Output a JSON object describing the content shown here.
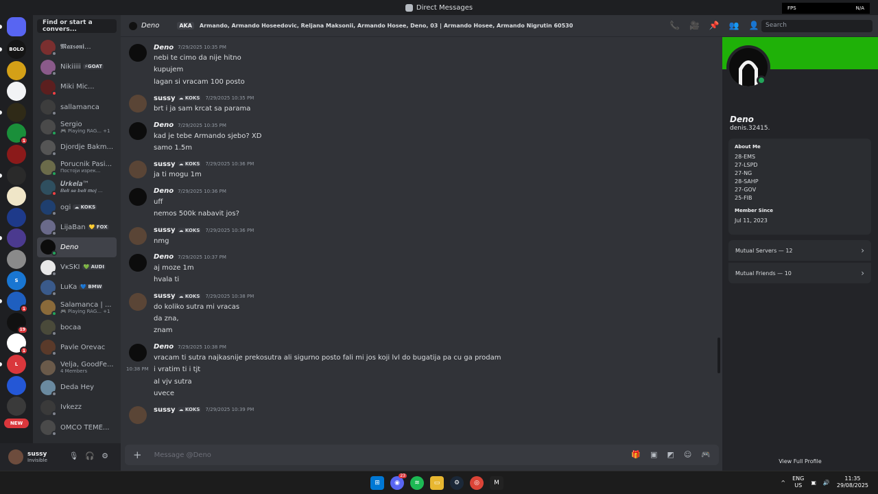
{
  "titlebar": {
    "title": "Direct Messages",
    "fps_label": "FPS",
    "fps_value": "N/A"
  },
  "servers": [
    {
      "label": "",
      "bg": "#5865f2",
      "dm": true
    },
    {
      "label": "BOLO",
      "bg": "#151515"
    },
    {
      "label": "",
      "bg": "#d4a017"
    },
    {
      "label": "",
      "bg": "#f2f3f5"
    },
    {
      "label": "",
      "bg": "#2f2a17"
    },
    {
      "label": "",
      "bg": "#1a8f3a",
      "badge": "1"
    },
    {
      "label": "",
      "bg": "#8b1a1a"
    },
    {
      "label": "",
      "bg": "#2a2a2a"
    },
    {
      "label": "",
      "bg": "#f0e6c8"
    },
    {
      "label": "",
      "bg": "#1e3a8a"
    },
    {
      "label": "",
      "bg": "#4b3a8f"
    },
    {
      "label": "",
      "bg": "#8a8a8a"
    },
    {
      "label": "S",
      "bg": "#1976d2"
    },
    {
      "label": "",
      "bg": "#1f5fbf",
      "badge": "1"
    },
    {
      "label": "",
      "bg": "#111111",
      "badge": "19"
    },
    {
      "label": "",
      "bg": "#ffffff",
      "badge": "1"
    },
    {
      "label": "L",
      "bg": "#da373c"
    },
    {
      "label": "",
      "bg": "#2457d6"
    },
    {
      "label": "",
      "bg": "#3a3a3a"
    }
  ],
  "new_label": "NEW",
  "dm_search": "Find or start a convers...",
  "dms": [
    {
      "name": "𝕸𝖆𝖝𝖘𝖔𝖓𝖎...",
      "sub": "",
      "tag": "",
      "av": "#7a2f2f",
      "status": "#80848e"
    },
    {
      "name": "Nikiiiii",
      "sub": "",
      "tag": "⚡GOAT",
      "av": "#8a5a8a",
      "status": "#80848e"
    },
    {
      "name": "Miki Mic...",
      "sub": "",
      "tag": "",
      "av": "#5c1f1f",
      "status": "#f23f43"
    },
    {
      "name": "sallamanca",
      "sub": "",
      "tag": "",
      "av": "#3d3d3d",
      "status": "#80848e"
    },
    {
      "name": "Sergio",
      "sub": "🎮 Playing RAG... +1",
      "tag": "",
      "av": "#4a4a4a",
      "status": "#23a55a"
    },
    {
      "name": "Djordje Bakm...",
      "sub": "",
      "tag": "",
      "av": "#555555",
      "status": "#80848e"
    },
    {
      "name": "Porucnik Pasi...",
      "sub": "Постоји изрек...",
      "tag": "",
      "av": "#6b6b4a",
      "status": "#23a55a"
    },
    {
      "name": "𝑼𝒓𝒌𝒆𝒍𝒂™",
      "sub": "𝑩𝒆𝒍𝒊 𝒔𝒆 𝒃𝒆𝒍𝒊 𝒎𝒐𝒋 ...",
      "tag": "",
      "av": "#2f4f5f",
      "status": "#f23f43"
    },
    {
      "name": "ogi",
      "sub": "",
      "tag": "☁ KOKS",
      "av": "#1f3f6f",
      "status": "#80848e"
    },
    {
      "name": "LijaBan",
      "sub": "",
      "tag": "💛 FOX",
      "av": "#6a6a8a",
      "status": "#80848e"
    },
    {
      "name": "Deno",
      "sub": "",
      "tag": "",
      "av": "#0c0c0c",
      "status": "#23a55a",
      "active": true
    },
    {
      "name": "VĸSKI",
      "sub": "",
      "tag": "💚 AUDI",
      "av": "#e8e8e8",
      "status": "#80848e"
    },
    {
      "name": "LuKa",
      "sub": "",
      "tag": "💙 BMW",
      "av": "#3a5a8a",
      "status": "#80848e"
    },
    {
      "name": "Salamanca | ...",
      "sub": "🎮 Playing RAG... +1",
      "tag": "",
      "av": "#8a6a3a",
      "status": "#23a55a"
    },
    {
      "name": "bocaa",
      "sub": "",
      "tag": "",
      "av": "#4a4a3a",
      "status": "#80848e"
    },
    {
      "name": "Pavle Orevac",
      "sub": "",
      "tag": "",
      "av": "#5a3a2a",
      "status": "#80848e"
    },
    {
      "name": "Velja, GoodFe...",
      "sub": "4 Members",
      "tag": "",
      "av": "#6a5a4a",
      "status": ""
    },
    {
      "name": "Deda Hey",
      "sub": "",
      "tag": "",
      "av": "#6a8aa0",
      "status": "#80848e"
    },
    {
      "name": "Ivkezz",
      "sub": "",
      "tag": "",
      "av": "#3a3a3a",
      "status": "#80848e"
    },
    {
      "name": "ÔMĆÖ ŤĔMĔ...",
      "sub": "",
      "tag": "",
      "av": "#4a4a4a",
      "status": "#80848e"
    }
  ],
  "user": {
    "name": "sussy",
    "status": "Invisible"
  },
  "header": {
    "name": "Deno",
    "aka_label": "AKA",
    "aka_names": "Armando, Armando Hoseedovic, Reljana Maksonii, Armando Hosee, Deno, 03 | Armando Hosee, Armando Nigrutin 60530",
    "search_placeholder": "Search"
  },
  "messages": [
    {
      "author": "Deno",
      "tag": "",
      "time": "7/29/2025 10:35 PM",
      "lines": [
        {
          "text": "nebi te cimo da nije hitno"
        },
        {
          "text": "kupujem"
        },
        {
          "text": "lagan si vracam 100 posto"
        }
      ]
    },
    {
      "author": "sussy",
      "tag": "☁ KOKS",
      "time": "7/29/2025 10:35 PM",
      "lines": [
        {
          "text": "brt i ja sam krcat sa parama"
        }
      ]
    },
    {
      "author": "Deno",
      "tag": "",
      "time": "7/29/2025 10:35 PM",
      "lines": [
        {
          "text": "kad je tebe Armando sjebo? XD"
        },
        {
          "text": "samo 1.5m"
        }
      ]
    },
    {
      "author": "sussy",
      "tag": "☁ KOKS",
      "time": "7/29/2025 10:36 PM",
      "lines": [
        {
          "text": "ja ti mogu 1m"
        }
      ]
    },
    {
      "author": "Deno",
      "tag": "",
      "time": "7/29/2025 10:36 PM",
      "lines": [
        {
          "text": "uff"
        },
        {
          "text": "nemos 500k nabavit jos?"
        }
      ]
    },
    {
      "author": "sussy",
      "tag": "☁ KOKS",
      "time": "7/29/2025 10:36 PM",
      "lines": [
        {
          "text": "nmg"
        }
      ]
    },
    {
      "author": "Deno",
      "tag": "",
      "time": "7/29/2025 10:37 PM",
      "lines": [
        {
          "text": "aj moze 1m"
        },
        {
          "text": "hvala ti"
        }
      ]
    },
    {
      "author": "sussy",
      "tag": "☁ KOKS",
      "time": "7/29/2025 10:38 PM",
      "lines": [
        {
          "text": "do koliko sutra mi vracas"
        },
        {
          "text": "da zna,"
        },
        {
          "text": "znam"
        }
      ]
    },
    {
      "author": "Deno",
      "tag": "",
      "time": "7/29/2025 10:38 PM",
      "lines": [
        {
          "text": "vracam ti sutra najkasnije prekosutra ali sigurno posto fali mi jos koji lvl do bugatija pa cu ga prodam"
        },
        {
          "text": "i vratim  ti i tjt",
          "side_time": "10:38 PM"
        },
        {
          "text": "al vjv sutra"
        },
        {
          "text": "uvece"
        }
      ]
    },
    {
      "author": "sussy",
      "tag": "☁ KOKS",
      "time": "7/29/2025 10:39 PM",
      "lines": []
    }
  ],
  "composer": {
    "placeholder": "Message @Deno"
  },
  "profile": {
    "display_name": "Deno",
    "username": "denis.32415.",
    "about_title": "About Me",
    "about_lines": [
      "28-EMS",
      "27-LSPD",
      "27-NG",
      "28-SAHP",
      "27-GOV",
      "25-FIB"
    ],
    "member_since_title": "Member Since",
    "member_since": "Jul 11, 2023",
    "mutual_servers": "Mutual Servers — 12",
    "mutual_friends": "Mutual Friends — 10",
    "view_full": "View Full Profile",
    "banner_color": "#1fb108"
  },
  "taskbar": {
    "discord_badge": "23",
    "lang": "ENG",
    "region": "US",
    "time": "11:35",
    "date": "29/08/2025"
  }
}
